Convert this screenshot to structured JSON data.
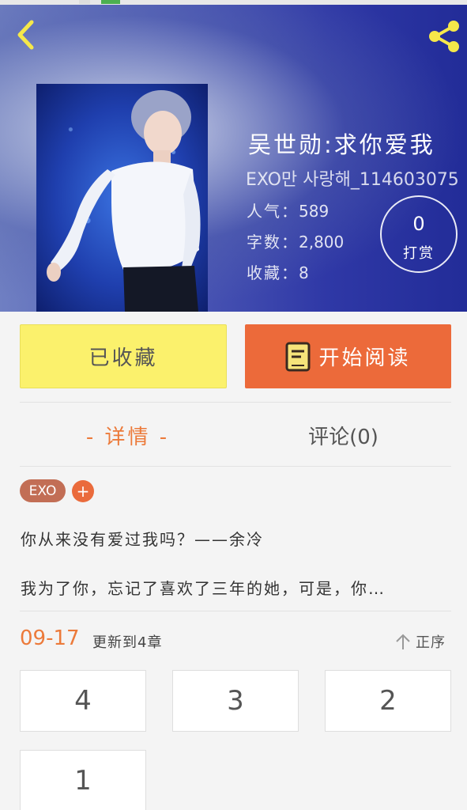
{
  "header": {
    "title": "吴世勋:求你爱我",
    "author": "EXO만 사랑해_114603075",
    "stats": {
      "popularity_label": "人气：",
      "popularity_value": "589",
      "words_label": "字数：",
      "words_value": "2,800",
      "favorites_label": "收藏：",
      "favorites_value": "8"
    },
    "tip": {
      "count": "0",
      "label": "打赏"
    }
  },
  "actions": {
    "favorite_label": "已收藏",
    "read_label": "开始阅读"
  },
  "tabs": {
    "detail_label": "- 详情 -",
    "comments_label": "评论(0)"
  },
  "tags": {
    "items": [
      "EXO"
    ],
    "add_label": "+"
  },
  "description": {
    "line1": "你从来没有爱过我吗？——余冷",
    "line2": "我为了你，忘记了喜欢了三年的她，可是，你…"
  },
  "chapters_bar": {
    "date": "09-17",
    "update_text": "更新到4章",
    "sort_label": "正序"
  },
  "chapters": [
    "4",
    "3",
    "2",
    "1"
  ],
  "colors": {
    "accent_orange": "#ec6a3a",
    "fav_yellow": "#fbf16c",
    "icon_yellow": "#f5e84a"
  },
  "icons": [
    "back-arrow-icon",
    "share-icon",
    "book-icon",
    "sort-up-arrow-icon"
  ]
}
